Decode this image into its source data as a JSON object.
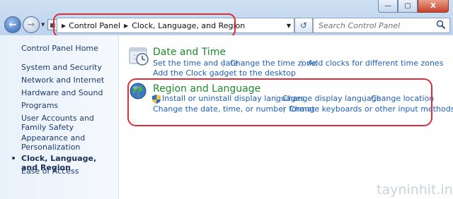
{
  "window": {
    "minimize": "—",
    "maximize": "▢",
    "close": "X"
  },
  "breadcrumb": {
    "items": [
      "Control Panel",
      "Clock, Language, and Region"
    ]
  },
  "search": {
    "placeholder": "Search Control Panel"
  },
  "sidebar": {
    "items": [
      {
        "label": "Control Panel Home"
      },
      {
        "label": "System and Security"
      },
      {
        "label": "Network and Internet"
      },
      {
        "label": "Hardware and Sound"
      },
      {
        "label": "Programs"
      },
      {
        "label": "User Accounts and Family Safety"
      },
      {
        "label": "Appearance and Personalization"
      },
      {
        "label": "Clock, Language, and Region"
      },
      {
        "label": "Ease of Access"
      }
    ]
  },
  "categories": [
    {
      "title": "Date and Time",
      "links": [
        "Set the time and date",
        "Change the time zone",
        "Add clocks for different time zones",
        "Add the Clock gadget to the desktop"
      ]
    },
    {
      "title": "Region and Language",
      "links": [
        "Install or uninstall display languages",
        "Change display language",
        "Change location",
        "Change the date, time, or number format",
        "Change keyboards or other input methods"
      ]
    }
  ],
  "watermark": "tayninhit.info",
  "colors": {
    "accent_link": "#1c5fbd",
    "category_title": "#1d8a2e",
    "annotation": "#e02b3b"
  }
}
